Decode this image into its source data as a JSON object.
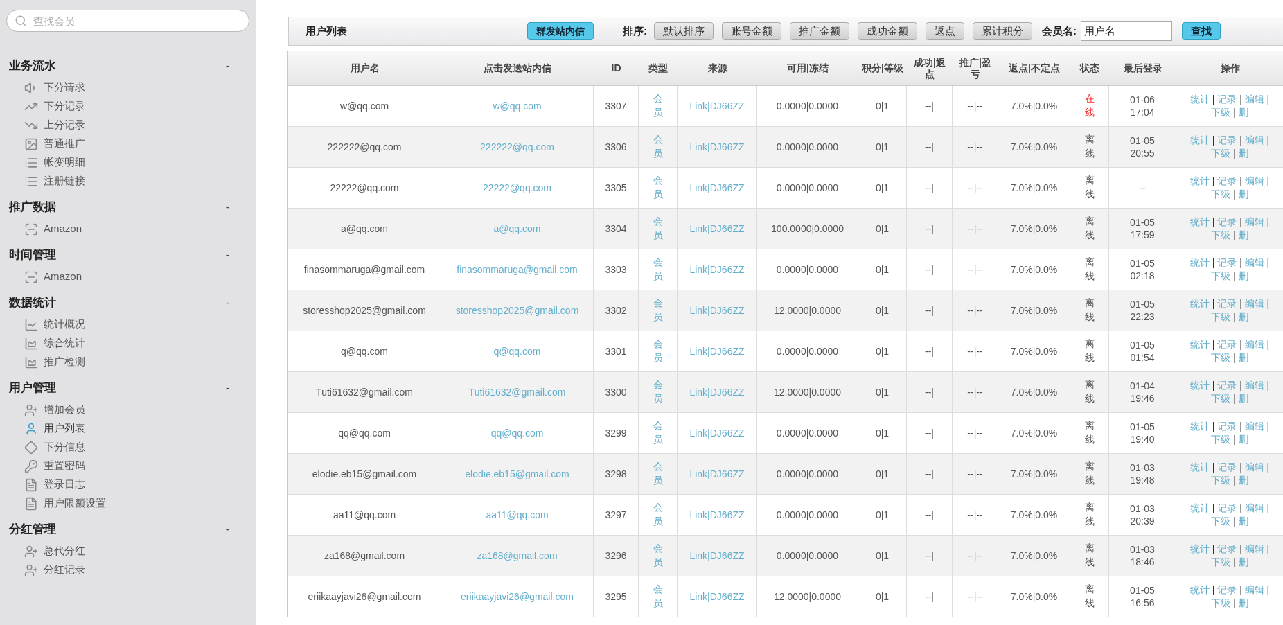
{
  "sidebar": {
    "search": {
      "placeholder": "查找会员"
    },
    "sections": [
      {
        "title": "业务流水",
        "toggle": "-",
        "items": [
          {
            "label": "下分请求",
            "selected": false
          },
          {
            "label": "下分记录",
            "selected": false
          },
          {
            "label": "上分记录",
            "selected": false
          },
          {
            "label": "普通推广",
            "selected": false
          },
          {
            "label": "帐变明细",
            "selected": false
          },
          {
            "label": "注册链接",
            "selected": false
          }
        ]
      },
      {
        "title": "推广数据",
        "toggle": "-",
        "items": [
          {
            "label": "Amazon",
            "selected": false
          }
        ]
      },
      {
        "title": "时间管理",
        "toggle": "-",
        "items": [
          {
            "label": "Amazon",
            "selected": false
          }
        ]
      },
      {
        "title": "数据统计",
        "toggle": "-",
        "items": [
          {
            "label": "统计概况",
            "selected": false
          },
          {
            "label": "综合统计",
            "selected": false
          },
          {
            "label": "推广检测",
            "selected": false
          }
        ]
      },
      {
        "title": "用户管理",
        "toggle": "-",
        "items": [
          {
            "label": "增加会员",
            "selected": false
          },
          {
            "label": "用户列表",
            "selected": true
          },
          {
            "label": "下分信息",
            "selected": false
          },
          {
            "label": "重置密码",
            "selected": false
          },
          {
            "label": "登录日志",
            "selected": false
          },
          {
            "label": "用户限额设置",
            "selected": false
          }
        ]
      },
      {
        "title": "分红管理",
        "toggle": "-",
        "items": [
          {
            "label": "总代分红",
            "selected": false
          },
          {
            "label": "分红记录",
            "selected": false
          }
        ]
      }
    ]
  },
  "toolbar": {
    "title": "用户列表",
    "broadcast_button": "群发站内信",
    "sort_label": "排序:",
    "sort_buttons": [
      "默认排序",
      "账号金额",
      "推广金额",
      "成功金额",
      "返点",
      "累计积分"
    ],
    "member_label": "会员名:",
    "member_field": {
      "value": "用户名"
    },
    "search_button": "查找"
  },
  "table": {
    "columns": [
      "用户名",
      "点击发送站内信",
      "ID",
      "类型",
      "来源",
      "可用|冻结",
      "积分|等级",
      "成功|返点",
      "推广|盈亏",
      "返点|不定点",
      "状态",
      "最后登录",
      "操作"
    ],
    "action_separator": "|",
    "rows": [
      {
        "user": "w@qq.com",
        "message_link": "w@qq.com",
        "id": "3307",
        "type": "会员",
        "source": "Link|DJ66ZZ",
        "balance": "0.0000|0.0000",
        "points": "0|1",
        "success": "--|",
        "promo": "--|--",
        "rebate": "7.0%|0.0%",
        "status": "在线",
        "online": true,
        "last_login": "01-06 17:04",
        "actions": [
          "统计",
          "记录",
          "编辑",
          "下级",
          "删"
        ]
      },
      {
        "user": "222222@qq.com",
        "message_link": "222222@qq.com",
        "id": "3306",
        "type": "会员",
        "source": "Link|DJ66ZZ",
        "balance": "0.0000|0.0000",
        "points": "0|1",
        "success": "--|",
        "promo": "--|--",
        "rebate": "7.0%|0.0%",
        "status": "离线",
        "online": false,
        "last_login": "01-05 20:55",
        "actions": [
          "统计",
          "记录",
          "编辑",
          "下级",
          "删"
        ]
      },
      {
        "user": "22222@qq.com",
        "message_link": "22222@qq.com",
        "id": "3305",
        "type": "会员",
        "source": "Link|DJ66ZZ",
        "balance": "0.0000|0.0000",
        "points": "0|1",
        "success": "--|",
        "promo": "--|--",
        "rebate": "7.0%|0.0%",
        "status": "离线",
        "online": false,
        "last_login": "--",
        "actions": [
          "统计",
          "记录",
          "编辑",
          "下级",
          "删"
        ]
      },
      {
        "user": "a@qq.com",
        "message_link": "a@qq.com",
        "id": "3304",
        "type": "会员",
        "source": "Link|DJ66ZZ",
        "balance": "100.0000|0.0000",
        "points": "0|1",
        "success": "--|",
        "promo": "--|--",
        "rebate": "7.0%|0.0%",
        "status": "离线",
        "online": false,
        "last_login": "01-05 17:59",
        "actions": [
          "统计",
          "记录",
          "编辑",
          "下级",
          "删"
        ]
      },
      {
        "user": "finasommaruga@gmail.com",
        "message_link": "finasommaruga@gmail.com",
        "id": "3303",
        "type": "会员",
        "source": "Link|DJ66ZZ",
        "balance": "0.0000|0.0000",
        "points": "0|1",
        "success": "--|",
        "promo": "--|--",
        "rebate": "7.0%|0.0%",
        "status": "离线",
        "online": false,
        "last_login": "01-05 02:18",
        "actions": [
          "统计",
          "记录",
          "编辑",
          "下级",
          "删"
        ]
      },
      {
        "user": "storesshop2025@gmail.com",
        "message_link": "storesshop2025@gmail.com",
        "id": "3302",
        "type": "会员",
        "source": "Link|DJ66ZZ",
        "balance": "12.0000|0.0000",
        "points": "0|1",
        "success": "--|",
        "promo": "--|--",
        "rebate": "7.0%|0.0%",
        "status": "离线",
        "online": false,
        "last_login": "01-05 22:23",
        "actions": [
          "统计",
          "记录",
          "编辑",
          "下级",
          "删"
        ]
      },
      {
        "user": "q@qq.com",
        "message_link": "q@qq.com",
        "id": "3301",
        "type": "会员",
        "source": "Link|DJ66ZZ",
        "balance": "0.0000|0.0000",
        "points": "0|1",
        "success": "--|",
        "promo": "--|--",
        "rebate": "7.0%|0.0%",
        "status": "离线",
        "online": false,
        "last_login": "01-05 01:54",
        "actions": [
          "统计",
          "记录",
          "编辑",
          "下级",
          "删"
        ]
      },
      {
        "user": "Tuti61632@gmail.com",
        "message_link": "Tuti61632@gmail.com",
        "id": "3300",
        "type": "会员",
        "source": "Link|DJ66ZZ",
        "balance": "12.0000|0.0000",
        "points": "0|1",
        "success": "--|",
        "promo": "--|--",
        "rebate": "7.0%|0.0%",
        "status": "离线",
        "online": false,
        "last_login": "01-04 19:46",
        "actions": [
          "统计",
          "记录",
          "编辑",
          "下级",
          "删"
        ]
      },
      {
        "user": "qq@qq.com",
        "message_link": "qq@qq.com",
        "id": "3299",
        "type": "会员",
        "source": "Link|DJ66ZZ",
        "balance": "0.0000|0.0000",
        "points": "0|1",
        "success": "--|",
        "promo": "--|--",
        "rebate": "7.0%|0.0%",
        "status": "离线",
        "online": false,
        "last_login": "01-05 19:40",
        "actions": [
          "统计",
          "记录",
          "编辑",
          "下级",
          "删"
        ]
      },
      {
        "user": "elodie.eb15@gmail.com",
        "message_link": "elodie.eb15@gmail.com",
        "id": "3298",
        "type": "会员",
        "source": "Link|DJ66ZZ",
        "balance": "0.0000|0.0000",
        "points": "0|1",
        "success": "--|",
        "promo": "--|--",
        "rebate": "7.0%|0.0%",
        "status": "离线",
        "online": false,
        "last_login": "01-03 19:48",
        "actions": [
          "统计",
          "记录",
          "编辑",
          "下级",
          "删"
        ]
      },
      {
        "user": "aa11@qq.com",
        "message_link": "aa11@qq.com",
        "id": "3297",
        "type": "会员",
        "source": "Link|DJ66ZZ",
        "balance": "0.0000|0.0000",
        "points": "0|1",
        "success": "--|",
        "promo": "--|--",
        "rebate": "7.0%|0.0%",
        "status": "离线",
        "online": false,
        "last_login": "01-03 20:39",
        "actions": [
          "统计",
          "记录",
          "编辑",
          "下级",
          "删"
        ]
      },
      {
        "user": "za168@gmail.com",
        "message_link": "za168@gmail.com",
        "id": "3296",
        "type": "会员",
        "source": "Link|DJ66ZZ",
        "balance": "0.0000|0.0000",
        "points": "0|1",
        "success": "--|",
        "promo": "--|--",
        "rebate": "7.0%|0.0%",
        "status": "离线",
        "online": false,
        "last_login": "01-03 18:46",
        "actions": [
          "统计",
          "记录",
          "编辑",
          "下级",
          "删"
        ]
      },
      {
        "user": "eriikaayjavi26@gmail.com",
        "message_link": "eriikaayjavi26@gmail.com",
        "id": "3295",
        "type": "会员",
        "source": "Link|DJ66ZZ",
        "balance": "12.0000|0.0000",
        "points": "0|1",
        "success": "--|",
        "promo": "--|--",
        "rebate": "7.0%|0.0%",
        "status": "离线",
        "online": false,
        "last_login": "01-05 16:56",
        "actions": [
          "统计",
          "记录",
          "编辑",
          "下级",
          "删"
        ]
      }
    ]
  }
}
